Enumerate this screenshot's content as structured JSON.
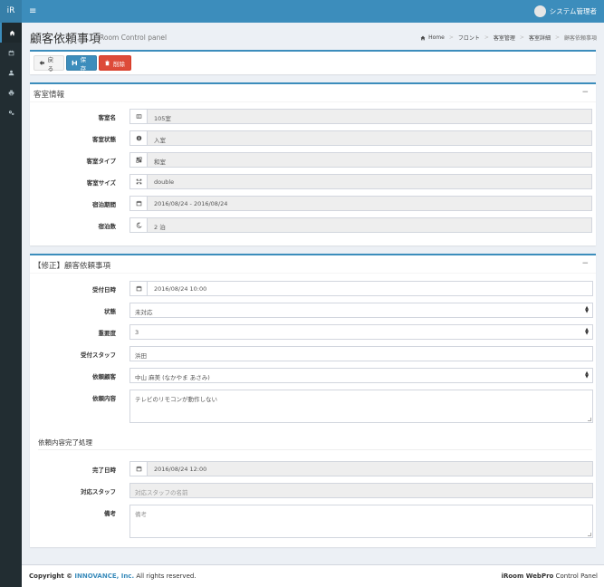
{
  "header": {
    "logo": "iR",
    "menu_icon": "≡",
    "user_name": "システム管理者"
  },
  "sidebar": {
    "items": [
      {
        "icon": "home-icon"
      },
      {
        "icon": "calendar-icon"
      },
      {
        "icon": "user-icon"
      },
      {
        "icon": "print-icon"
      },
      {
        "icon": "cogs-icon"
      }
    ]
  },
  "page": {
    "title": "顧客依頼事項",
    "subtitle": "Room Control panel",
    "breadcrumb": [
      "Home",
      "フロント",
      "客室管理",
      "客室詳細",
      "顧客依頼事項"
    ]
  },
  "toolbar": {
    "back_label": "戻る",
    "save_label": "保存",
    "delete_label": "削除"
  },
  "room_info": {
    "title": "客室情報",
    "collapse": "−",
    "rows": [
      {
        "label": "客室名",
        "value": "105室",
        "icon": "room-icon"
      },
      {
        "label": "客室状態",
        "value": "入室",
        "icon": "info-icon"
      },
      {
        "label": "客室タイプ",
        "value": "和室",
        "icon": "type-icon"
      },
      {
        "label": "客室サイズ",
        "value": "double",
        "icon": "expand-icon"
      },
      {
        "label": "宿泊期間",
        "value": "2016/08/24 - 2016/08/24",
        "icon": "calendar-icon"
      },
      {
        "label": "宿泊数",
        "value": "2 泊",
        "icon": "moon-icon"
      }
    ]
  },
  "request": {
    "title": "【修正】顧客依頼事項",
    "collapse": "−",
    "received_label": "受付日時",
    "received_value": "2016/08/24 10:00",
    "status_label": "状態",
    "status_value": "未対応",
    "priority_label": "重要度",
    "priority_value": "3",
    "staff_label": "受付スタッフ",
    "staff_value": "浜田",
    "customer_label": "依頼顧客",
    "customer_value": "中山 麻美 (なかやま あさみ)",
    "content_label": "依頼内容",
    "content_value": "テレビのリモコンが動作しない",
    "completion_heading": "依頼内容完了処理",
    "completed_label": "完了日時",
    "completed_value": "2016/08/24 12:00",
    "handler_label": "対応スタッフ",
    "handler_placeholder": "対応スタッフの名前",
    "notes_label": "備考",
    "notes_placeholder": "備考"
  },
  "footer": {
    "copyright_prefix": "Copyright ©",
    "company": "INNOVANCE, Inc.",
    "rights": "All rights reserved.",
    "product_bold": "iRoom WebPro",
    "product_rest": "Control Panel"
  },
  "colors": {
    "primary": "#3c8dbc",
    "danger": "#dd4b39",
    "sidebar": "#222d32"
  }
}
